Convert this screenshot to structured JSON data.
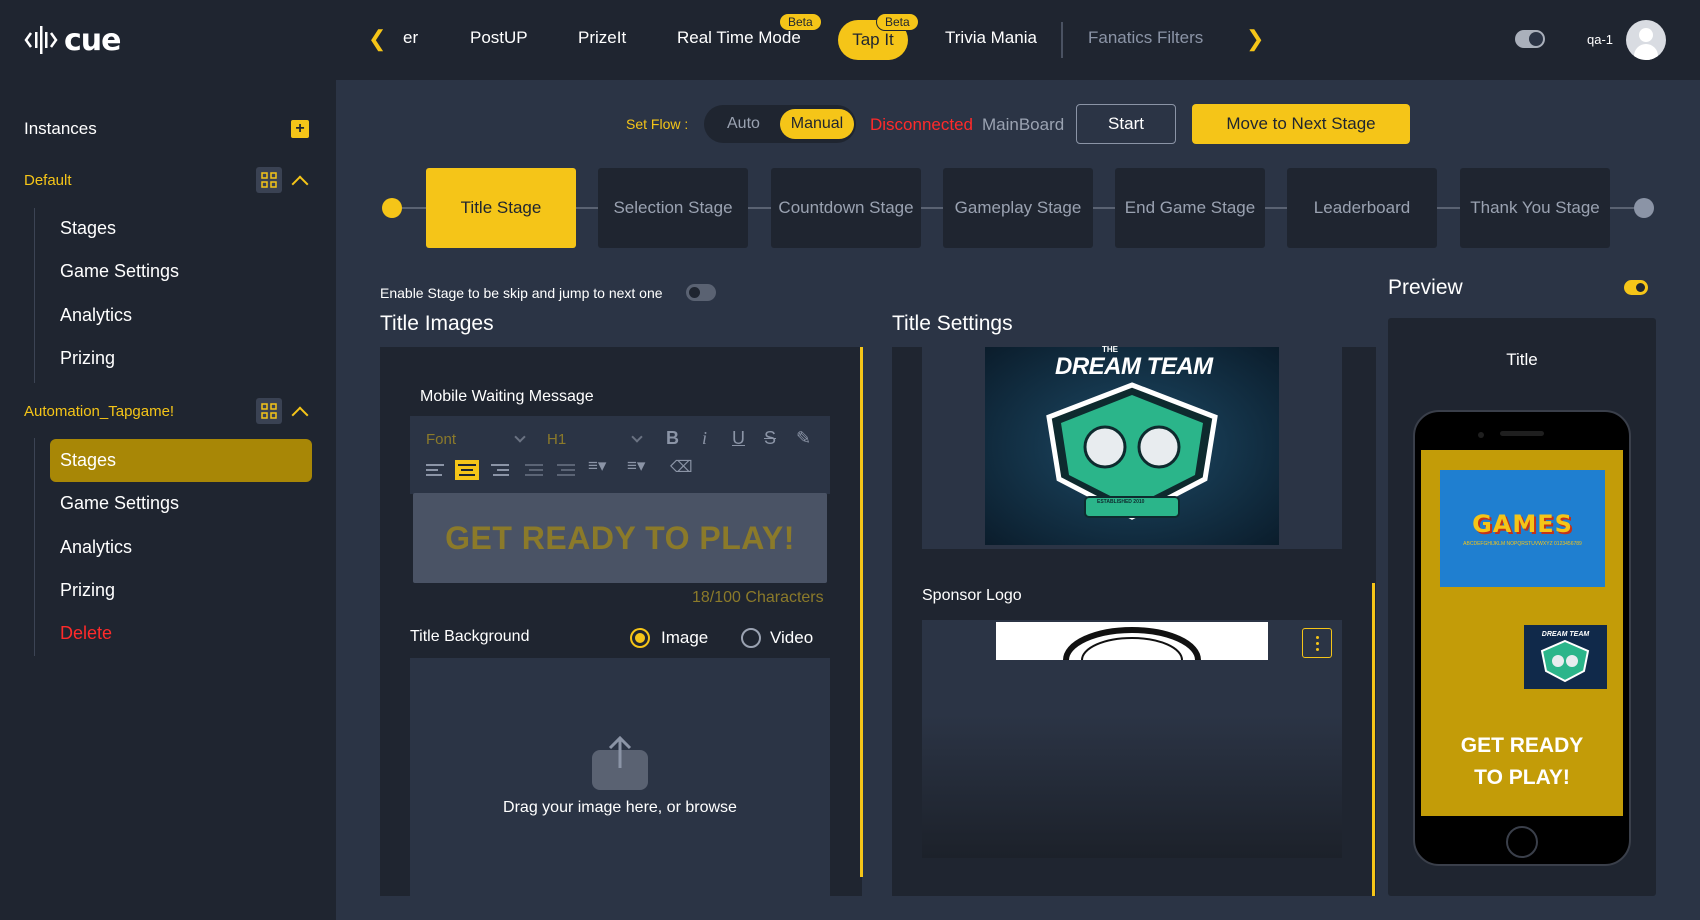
{
  "app": {
    "logo_text": "cue"
  },
  "topnav": {
    "items": [
      {
        "label": "er"
      },
      {
        "label": "PostUP"
      },
      {
        "label": "PrizeIt"
      },
      {
        "label": "Real Time Mode",
        "badge": "Beta"
      },
      {
        "label": "Tap It",
        "badge": "Beta",
        "selected": true
      },
      {
        "label": "Trivia Mania"
      },
      {
        "label": "Fanatics Filters"
      }
    ],
    "user_name": "qa-1"
  },
  "sidebar": {
    "title": "Instances",
    "groups": [
      {
        "name": "Default",
        "items": [
          "Stages",
          "Game Settings",
          "Analytics",
          "Prizing"
        ]
      },
      {
        "name": "Automation_Tapgame!",
        "items": [
          "Stages",
          "Game Settings",
          "Analytics",
          "Prizing",
          "Delete"
        ]
      }
    ]
  },
  "flow": {
    "label": "Set Flow :",
    "auto_label": "Auto",
    "manual_label": "Manual",
    "status_disconnected": "Disconnected",
    "status_board": "MainBoard",
    "start_label": "Start",
    "next_stage_label": "Move to Next Stage"
  },
  "stages": [
    "Title Stage",
    "Selection Stage",
    "Countdown Stage",
    "Gameplay Stage",
    "End Game Stage",
    "Leaderboard",
    "Thank You Stage"
  ],
  "skip_toggle_label": "Enable Stage to be skip and jump to next one",
  "title_images": {
    "heading": "Title Images",
    "waiting_label": "Mobile Waiting Message",
    "font_select": "Font",
    "heading_select": "H1",
    "editor_text": "GET READY TO PLAY!",
    "char_count": "18/100 Characters",
    "background_label": "Title Background",
    "opt_image": "Image",
    "opt_video": "Video",
    "drop_text": "Drag your image here, or browse"
  },
  "title_settings": {
    "heading": "Title Settings",
    "sponsor_label": "Sponsor Logo",
    "dream_team_top": "THE",
    "dream_team_name": "DREAM TEAM",
    "dream_team_est": "ESTABLISHED 2010"
  },
  "preview": {
    "heading": "Preview",
    "label": "Title",
    "banner_word": "GAMES",
    "banner_sub": "ABCDEFGHIJKLM NOPQRSTUVWXYZ 0123456789",
    "mini_logo_text": "DREAM TEAM",
    "phone_text_line1": "GET READY",
    "phone_text_line2": "TO PLAY!"
  },
  "colors": {
    "accent": "#f5c518",
    "danger": "#ff2a2a",
    "bg": "#2b3445",
    "panel": "#1f2530"
  }
}
